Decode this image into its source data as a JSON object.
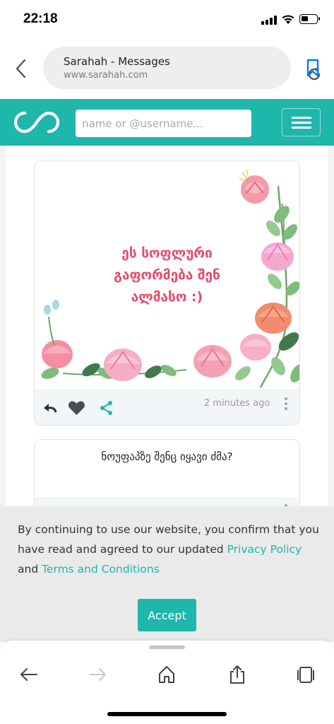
{
  "status_bar": {
    "time": "22:18"
  },
  "browser": {
    "page_title": "Sarahah - Messages",
    "url": "www.sarahah.com"
  },
  "header": {
    "search_placeholder": "name or @username..."
  },
  "messages": [
    {
      "text_lines": [
        "ეს სოფლური",
        "გაფორმება შენ",
        "ალმასო :)"
      ],
      "time_ago": "2 minutes ago"
    },
    {
      "text": "ნოუფაპზე შენც იყავი ძმა?"
    }
  ],
  "cookie_banner": {
    "text_before": "By continuing to use our website, you confirm that you have read and agreed to our updated ",
    "privacy_link": "Privacy Policy",
    "text_middle": " and ",
    "terms_link": "Terms and Conditions",
    "accept_label": "Accept"
  },
  "colors": {
    "brand": "#1fb6ac",
    "message_text": "#e84a6b",
    "ios_blue": "#007aff"
  },
  "icons": [
    "back-chevron-icon",
    "reload-icon",
    "bookmark-icon",
    "sarahah-logo",
    "hamburger-menu-icon",
    "reply-icon",
    "heart-icon",
    "share-icon",
    "more-vertical-icon",
    "arrow-left-icon",
    "arrow-right-icon",
    "home-icon",
    "share-upload-icon",
    "tabs-icon"
  ]
}
